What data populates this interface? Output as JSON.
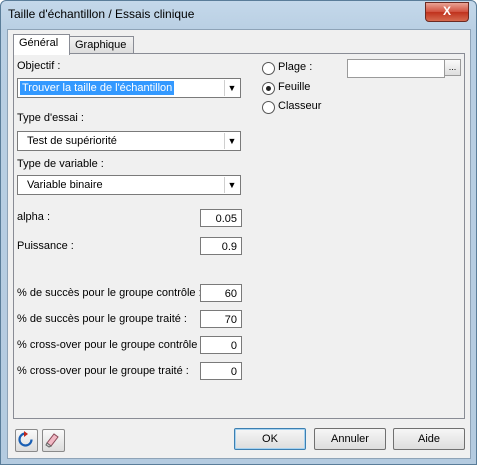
{
  "window": {
    "title": "Taille d'échantillon / Essais clinique",
    "close_label": "X"
  },
  "tabs": [
    {
      "label": "Général"
    },
    {
      "label": "Graphique"
    }
  ],
  "form": {
    "objectif_label": "Objectif :",
    "objectif_value": "Trouver la taille de l'échantillon",
    "type_essai_label": "Type d'essai :",
    "type_essai_value": "Test de supériorité",
    "type_variable_label": "Type de variable :",
    "type_variable_value": "Variable binaire",
    "alpha_label": "alpha :",
    "alpha_value": "0.05",
    "puissance_label": "Puissance :",
    "puissance_value": "0.9",
    "succes_controle_label": "% de succès pour le groupe contrôle :",
    "succes_controle_value": "60",
    "succes_traite_label": "% de succès pour le groupe traité :",
    "succes_traite_value": "70",
    "crossover_controle_label": "% cross-over pour le groupe contrôle :",
    "crossover_controle_value": "0",
    "crossover_traite_label": "% cross-over pour le groupe traité :",
    "crossover_traite_value": "0"
  },
  "output": {
    "plage_label": "Plage :",
    "feuille_label": "Feuille",
    "classeur_label": "Classeur",
    "selected": "Feuille",
    "range_button": "..."
  },
  "buttons": {
    "ok": "OK",
    "cancel": "Annuler",
    "help": "Aide"
  },
  "icons": {
    "reset": "refresh-icon",
    "clear": "eraser-icon"
  }
}
